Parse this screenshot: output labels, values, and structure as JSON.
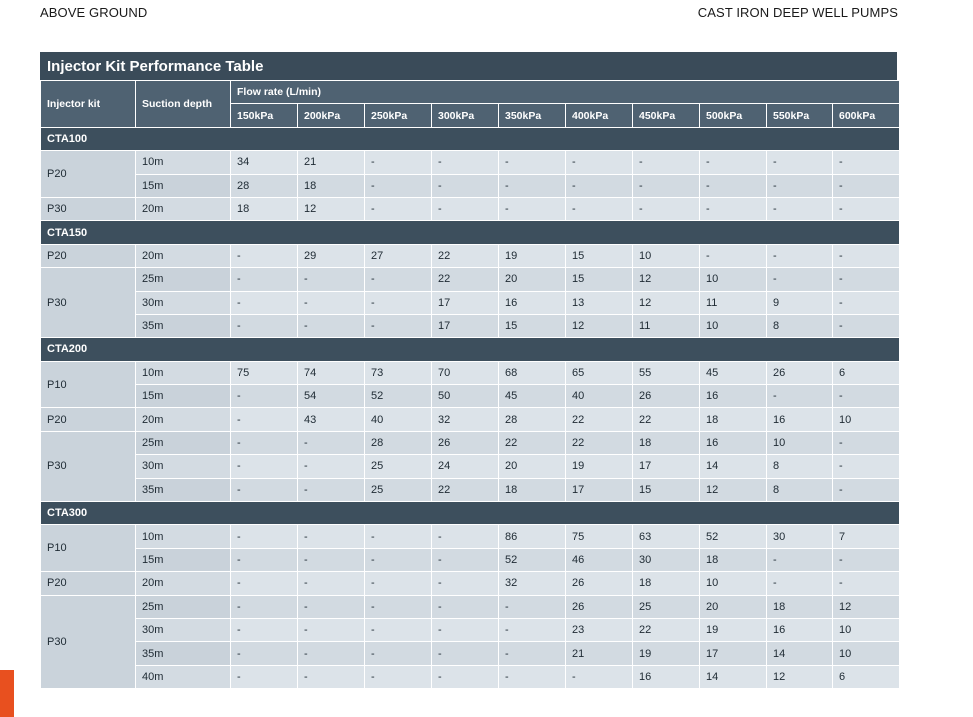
{
  "header": {
    "left": "ABOVE GROUND",
    "right": "CAST IRON DEEP WELL PUMPS"
  },
  "colors": {
    "title_bar": "#3a4b59",
    "group_bar": "#3d4f5d",
    "header_cell": "#4f6272",
    "cell": "#dce3e9",
    "side_tab": "#e8501f"
  },
  "table": {
    "title": "Injector Kit Performance Table",
    "col_kit": "Injector kit",
    "col_depth": "Suction depth",
    "col_flow": "Flow rate (L/min)",
    "pressures": [
      "150kPa",
      "200kPa",
      "250kPa",
      "300kPa",
      "350kPa",
      "400kPa",
      "450kPa",
      "500kPa",
      "550kPa",
      "600kPa"
    ],
    "groups": [
      {
        "name": "CTA100",
        "kits": [
          {
            "kit": "P20",
            "rows": [
              {
                "depth": "10m",
                "values": [
                  "34",
                  "21",
                  "-",
                  "-",
                  "-",
                  "-",
                  "-",
                  "-",
                  "-",
                  "-"
                ]
              },
              {
                "depth": "15m",
                "values": [
                  "28",
                  "18",
                  "-",
                  "-",
                  "-",
                  "-",
                  "-",
                  "-",
                  "-",
                  "-"
                ]
              }
            ]
          },
          {
            "kit": "P30",
            "rows": [
              {
                "depth": "20m",
                "values": [
                  "18",
                  "12",
                  "-",
                  "-",
                  "-",
                  "-",
                  "-",
                  "-",
                  "-",
                  "-"
                ]
              }
            ]
          }
        ]
      },
      {
        "name": "CTA150",
        "kits": [
          {
            "kit": "P20",
            "rows": [
              {
                "depth": "20m",
                "values": [
                  "-",
                  "29",
                  "27",
                  "22",
                  "19",
                  "15",
                  "10",
                  "-",
                  "-",
                  "-"
                ]
              }
            ]
          },
          {
            "kit": "P30",
            "rows": [
              {
                "depth": "25m",
                "values": [
                  "-",
                  "-",
                  "-",
                  "22",
                  "20",
                  "15",
                  "12",
                  "10",
                  "-",
                  "-"
                ]
              },
              {
                "depth": "30m",
                "values": [
                  "-",
                  "-",
                  "-",
                  "17",
                  "16",
                  "13",
                  "12",
                  "11",
                  "9",
                  "-"
                ]
              },
              {
                "depth": "35m",
                "values": [
                  "-",
                  "-",
                  "-",
                  "17",
                  "15",
                  "12",
                  "11",
                  "10",
                  "8",
                  "-"
                ]
              }
            ]
          }
        ]
      },
      {
        "name": "CTA200",
        "kits": [
          {
            "kit": "P10",
            "rows": [
              {
                "depth": "10m",
                "values": [
                  "75",
                  "74",
                  "73",
                  "70",
                  "68",
                  "65",
                  "55",
                  "45",
                  "26",
                  "6"
                ]
              },
              {
                "depth": "15m",
                "values": [
                  "-",
                  "54",
                  "52",
                  "50",
                  "45",
                  "40",
                  "26",
                  "16",
                  "-",
                  "-"
                ]
              }
            ]
          },
          {
            "kit": "P20",
            "rows": [
              {
                "depth": "20m",
                "values": [
                  "-",
                  "43",
                  "40",
                  "32",
                  "28",
                  "22",
                  "22",
                  "18",
                  "16",
                  "10"
                ]
              }
            ]
          },
          {
            "kit": "P30",
            "rows": [
              {
                "depth": "25m",
                "values": [
                  "-",
                  "-",
                  "28",
                  "26",
                  "22",
                  "22",
                  "18",
                  "16",
                  "10",
                  "-"
                ]
              },
              {
                "depth": "30m",
                "values": [
                  "-",
                  "-",
                  "25",
                  "24",
                  "20",
                  "19",
                  "17",
                  "14",
                  "8",
                  "-"
                ]
              },
              {
                "depth": "35m",
                "values": [
                  "-",
                  "-",
                  "25",
                  "22",
                  "18",
                  "17",
                  "15",
                  "12",
                  "8",
                  "-"
                ]
              }
            ]
          }
        ]
      },
      {
        "name": "CTA300",
        "kits": [
          {
            "kit": "P10",
            "rows": [
              {
                "depth": "10m",
                "values": [
                  "-",
                  "-",
                  "-",
                  "-",
                  "86",
                  "75",
                  "63",
                  "52",
                  "30",
                  "7"
                ]
              },
              {
                "depth": "15m",
                "values": [
                  "-",
                  "-",
                  "-",
                  "-",
                  "52",
                  "46",
                  "30",
                  "18",
                  "-",
                  "-"
                ]
              }
            ]
          },
          {
            "kit": "P20",
            "rows": [
              {
                "depth": "20m",
                "values": [
                  "-",
                  "-",
                  "-",
                  "-",
                  "32",
                  "26",
                  "18",
                  "10",
                  "-",
                  "-"
                ]
              }
            ]
          },
          {
            "kit": "P30",
            "rows": [
              {
                "depth": "25m",
                "values": [
                  "-",
                  "-",
                  "-",
                  "-",
                  "-",
                  "26",
                  "25",
                  "20",
                  "18",
                  "12"
                ]
              },
              {
                "depth": "30m",
                "values": [
                  "-",
                  "-",
                  "-",
                  "-",
                  "-",
                  "23",
                  "22",
                  "19",
                  "16",
                  "10"
                ]
              },
              {
                "depth": "35m",
                "values": [
                  "-",
                  "-",
                  "-",
                  "-",
                  "-",
                  "21",
                  "19",
                  "17",
                  "14",
                  "10"
                ]
              },
              {
                "depth": "40m",
                "values": [
                  "-",
                  "-",
                  "-",
                  "-",
                  "-",
                  "-",
                  "16",
                  "14",
                  "12",
                  "6"
                ]
              }
            ]
          }
        ]
      }
    ]
  }
}
